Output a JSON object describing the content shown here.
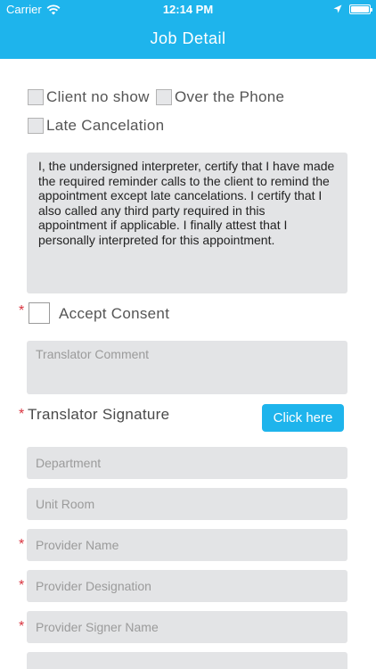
{
  "status_bar": {
    "carrier": "Carrier",
    "time": "12:14 PM"
  },
  "nav": {
    "title": "Job Detail"
  },
  "options": {
    "client_no_show": "Client no show",
    "over_the_phone": "Over the Phone",
    "late_cancelation": "Late Cancelation"
  },
  "consent_text": "I, the undersigned interpreter, certify that I have made the required reminder calls to the client to remind the appointment except late cancelations. I certify that I also called any third party required in this appointment if applicable. I finally attest that I personally interpreted for this appointment.",
  "required_marker": "*",
  "accept_consent_label": "Accept Consent",
  "translator_comment_placeholder": "Translator Comment",
  "translator_signature_label": "Translator Signature",
  "click_here_label": "Click here",
  "fields": {
    "department": "Department",
    "unit_room": "Unit Room",
    "provider_name": "Provider Name",
    "provider_designation": "Provider Designation",
    "provider_signer_name": "Provider Signer Name"
  },
  "colors": {
    "accent": "#1eb4ec",
    "required": "#d9343f",
    "field_bg": "#e3e4e6"
  }
}
